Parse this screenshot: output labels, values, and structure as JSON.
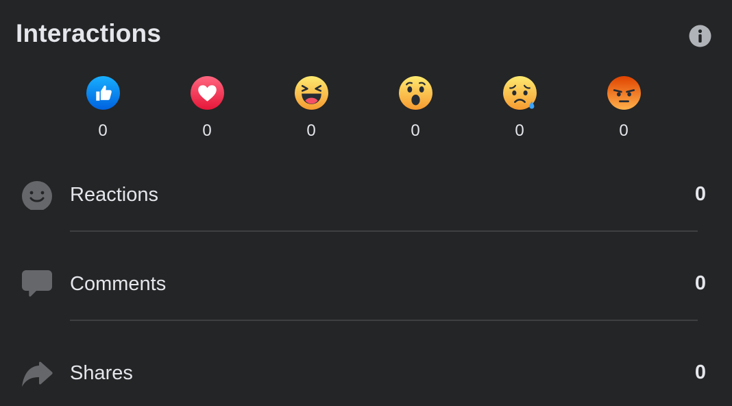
{
  "header": {
    "title": "Interactions"
  },
  "reactions": [
    {
      "icon": "like-icon",
      "count": "0"
    },
    {
      "icon": "love-icon",
      "count": "0"
    },
    {
      "icon": "haha-icon",
      "count": "0"
    },
    {
      "icon": "wow-icon",
      "count": "0"
    },
    {
      "icon": "sad-icon",
      "count": "0"
    },
    {
      "icon": "angry-icon",
      "count": "0"
    }
  ],
  "metrics": [
    {
      "icon": "smiley-icon",
      "label": "Reactions",
      "value": "0"
    },
    {
      "icon": "comment-icon",
      "label": "Comments",
      "value": "0"
    },
    {
      "icon": "share-icon",
      "label": "Shares",
      "value": "0"
    }
  ],
  "colors": {
    "background": "#242526",
    "text": "#e4e6eb",
    "divider": "#3e4042",
    "icon_gray": "#65676b",
    "like_blue": "#1877f2",
    "love_red": "#f33e58",
    "emoji_yellow": "#f7b125",
    "angry_orange": "#e9710f"
  }
}
